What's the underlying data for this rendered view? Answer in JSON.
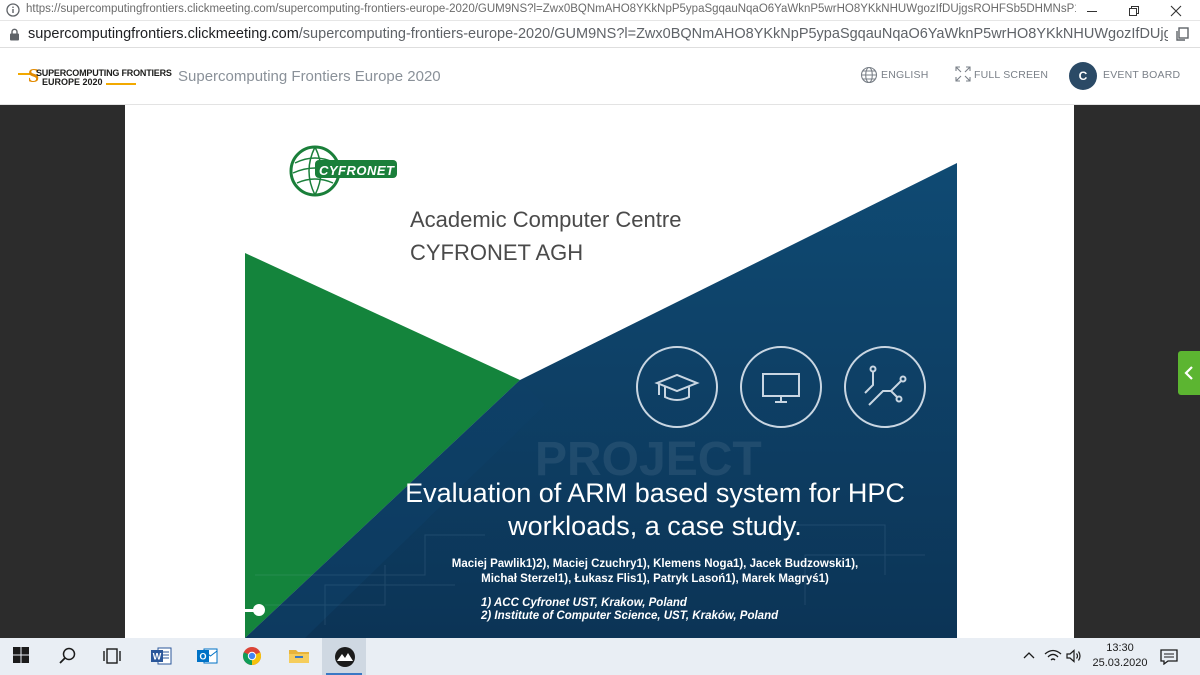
{
  "browser": {
    "window_url": "https://supercomputingfrontiers.clickmeeting.com/supercomputing-frontiers-europe-2020/GUM9NS?l=Zwx0BQNmAHO8YKkNpP5ypaSgqauNqaO6YaWknP5wrHO8YKkNHUWgozIfDUjgsROHFSb5DHMNsP18D...",
    "address_host": "supercomputingfrontiers.clickmeeting.com",
    "address_path": "/supercomputing-frontiers-europe-2020/GUM9NS?l=Zwx0BQNmAHO8YKkNpP5ypaSgqauNqaO6YaWknP5wrHO8YKkNHUWgozIfDUjgsROHFSb5DHM..."
  },
  "header": {
    "logo_line1": "SUPERCOMPUTING FRONTIERS",
    "logo_line2": "EUROPE 2020",
    "event_title": "Supercomputing Frontiers Europe 2020",
    "language_label": "ENGLISH",
    "fullscreen_label": "FULL SCREEN",
    "avatar_initial": "C",
    "event_board_label": "EVENT BOARD"
  },
  "slide": {
    "logo_text": "CYFRONET",
    "org_line1": "Academic Computer Centre",
    "org_line2": "CYFRONET AGH",
    "title_line1": "Evaluation of ARM based system for HPC",
    "title_line2": "workloads, a case study.",
    "authors_line1": "Maciej Pawlik1)2), Maciej Czuchry1), Klemens Noga1), Jacek Budzowski1),",
    "authors_line2": "Michał Sterzel1), Łukasz Flis1), Patryk Lasoń1), Marek Magryś1)",
    "affiliation1": "1) ACC Cyfronet UST, Krakow, Poland",
    "affiliation2": "2) Institute of Computer Science, UST, Kraków, Poland",
    "icons": [
      "graduation-cap-icon",
      "monitor-icon",
      "circuit-icon"
    ]
  },
  "player": {
    "volume_percent": 100
  },
  "taskbar": {
    "time": "13:30",
    "date": "25.03.2020"
  },
  "colors": {
    "green": "#14843c",
    "navy": "#0f3d63",
    "accent_tab": "#5cb531"
  }
}
